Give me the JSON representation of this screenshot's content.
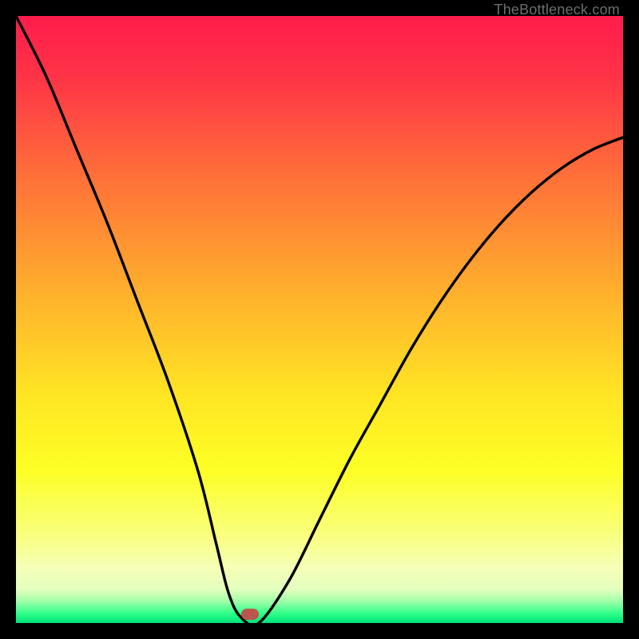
{
  "watermark": "TheBottleneck.com",
  "chart_data": {
    "type": "line",
    "title": "",
    "xlabel": "",
    "ylabel": "",
    "xlim": [
      0,
      100
    ],
    "ylim": [
      0,
      100
    ],
    "grid": false,
    "series": [
      {
        "name": "bottleneck-curve",
        "x": [
          0,
          5,
          10,
          15,
          20,
          25,
          30,
          33,
          35,
          37,
          40,
          45,
          50,
          55,
          60,
          65,
          70,
          75,
          80,
          85,
          90,
          95,
          100
        ],
        "values": [
          100,
          90,
          78,
          66,
          53,
          40,
          25,
          13,
          5,
          1,
          0,
          7,
          17,
          27,
          36,
          45,
          53,
          60,
          66,
          71,
          75,
          78,
          80
        ]
      }
    ],
    "marker": {
      "x": 38.5,
      "y": 1.5,
      "color": "#b9574e"
    },
    "background_gradient": {
      "stops": [
        {
          "offset": 0.0,
          "color": "#ff1d4b"
        },
        {
          "offset": 0.1,
          "color": "#ff3347"
        },
        {
          "offset": 0.25,
          "color": "#ff6b3a"
        },
        {
          "offset": 0.45,
          "color": "#ffae2d"
        },
        {
          "offset": 0.62,
          "color": "#ffe424"
        },
        {
          "offset": 0.75,
          "color": "#fdff25"
        },
        {
          "offset": 0.85,
          "color": "#f9ff7a"
        },
        {
          "offset": 0.91,
          "color": "#f6ffb8"
        },
        {
          "offset": 0.945,
          "color": "#e3ffbd"
        },
        {
          "offset": 0.965,
          "color": "#9cffa8"
        },
        {
          "offset": 0.985,
          "color": "#2bff88"
        },
        {
          "offset": 1.0,
          "color": "#00e07a"
        }
      ]
    }
  }
}
